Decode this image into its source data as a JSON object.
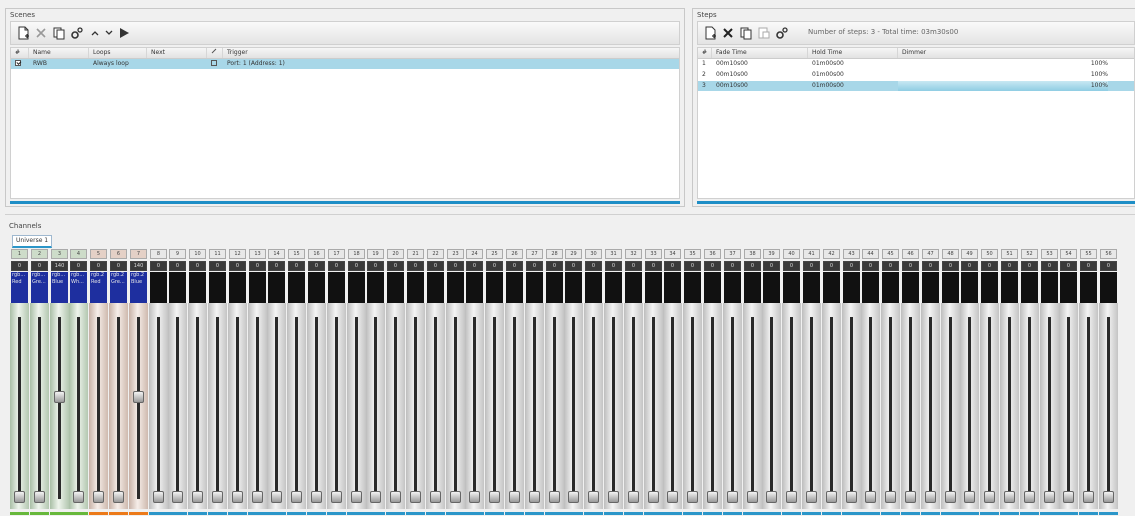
{
  "scenes": {
    "title": "Scenes",
    "toolbar": {
      "add_icon": "add-scene-icon",
      "delete_icon": "delete-icon",
      "copy_icon": "copy-icon",
      "settings_icon": "settings-icon",
      "up_icon": "arrow-up-icon",
      "down_icon": "arrow-down-icon",
      "play_icon": "play-icon"
    },
    "columns": [
      "#",
      "Name",
      "Loops",
      "Next",
      "",
      "Trigger"
    ],
    "rows": [
      {
        "checked": true,
        "name": "RWB",
        "loops": "Always loop",
        "next": "",
        "trigger_checked": false,
        "trigger": "Port: 1 (Address: 1)"
      }
    ]
  },
  "steps": {
    "title": "Steps",
    "summary": "Number of steps: 3 - Total time: 03m30s00",
    "columns": [
      "#",
      "Fade Time",
      "Hold Time",
      "Dimmer"
    ],
    "rows": [
      {
        "num": "1",
        "fade": "00m10s00",
        "hold": "01m00s00",
        "dimmer": "100%"
      },
      {
        "num": "2",
        "fade": "00m10s00",
        "hold": "01m00s00",
        "dimmer": "100%"
      },
      {
        "num": "3",
        "fade": "00m10s00",
        "hold": "01m00s00",
        "dimmer": "100%"
      }
    ]
  },
  "channels": {
    "title": "Channels",
    "tab": "Universe 1",
    "fixtures": [
      {
        "num": "1",
        "value": "0",
        "label1": "rgb...",
        "label2": "Red",
        "group": "g",
        "level": 0
      },
      {
        "num": "2",
        "value": "0",
        "label1": "rgb...",
        "label2": "Gre...",
        "group": "g",
        "level": 0
      },
      {
        "num": "3",
        "value": "140",
        "label1": "rgb...",
        "label2": "Blue",
        "group": "g",
        "level": 0.55
      },
      {
        "num": "4",
        "value": "0",
        "label1": "rgb...",
        "label2": "Wh...",
        "group": "g",
        "level": 0
      },
      {
        "num": "5",
        "value": "0",
        "label1": "rgb.2",
        "label2": "Red",
        "group": "o",
        "level": 0
      },
      {
        "num": "6",
        "value": "0",
        "label1": "rgb.2",
        "label2": "Gre...",
        "group": "o",
        "level": 0
      },
      {
        "num": "7",
        "value": "140",
        "label1": "rgb.2",
        "label2": "Blue",
        "group": "o",
        "level": 0.55
      }
    ],
    "plain_numbers": [
      "8",
      "9",
      "10",
      "11",
      "12",
      "13",
      "14",
      "15",
      "16",
      "17",
      "18",
      "19",
      "20",
      "21",
      "22",
      "23",
      "24",
      "25",
      "26",
      "27",
      "28",
      "29",
      "30",
      "31",
      "32",
      "33",
      "34",
      "35",
      "36",
      "37",
      "38",
      "39",
      "40",
      "41",
      "42",
      "43",
      "44",
      "45",
      "46",
      "47",
      "48",
      "49",
      "50",
      "51",
      "52",
      "53",
      "54",
      "55",
      "56",
      "57"
    ],
    "plain_value": "0"
  }
}
